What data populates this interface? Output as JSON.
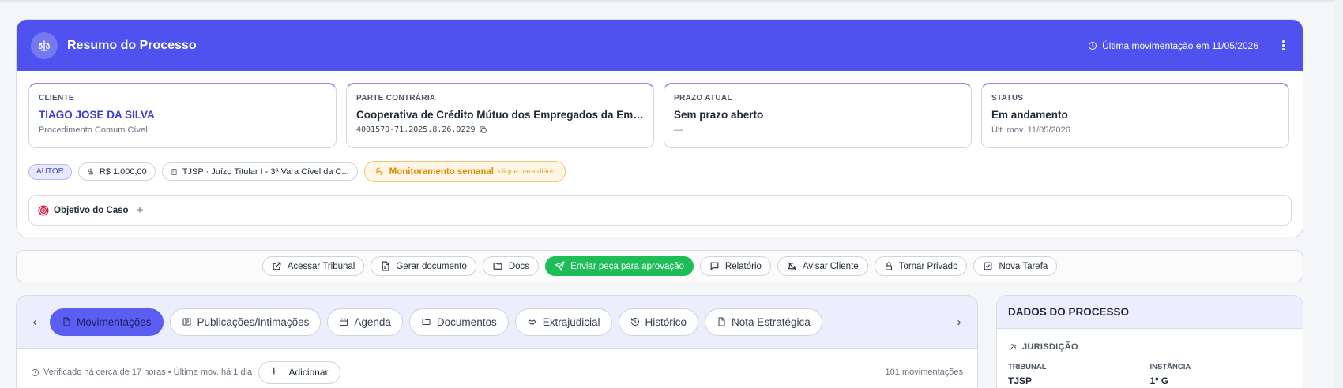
{
  "summary": {
    "title": "Resumo do Processo",
    "last_movement": "Última movimentação em 11/05/2026",
    "cards": [
      {
        "label": "CLIENTE",
        "value": "TIAGO JOSE DA SILVA",
        "sub": "Procedimento Comum Cível"
      },
      {
        "label": "PARTE CONTRÁRIA",
        "value": "Cooperativa de Crédito Mútuo dos Empregados da Embr...",
        "sub": "4001570-71.2025.8.26.0229"
      },
      {
        "label": "PRAZO ATUAL",
        "value": "Sem prazo aberto",
        "sub": "—"
      },
      {
        "label": "STATUS",
        "value": "Em andamento",
        "sub": "Últ. mov. 11/05/2026"
      }
    ],
    "chips": {
      "role": "AUTOR",
      "amount": "R$ 1.000,00",
      "court": "TJSP · Juízo Titular I - 3ª Vara Cível da C...",
      "monitor_label": "Monitoramento semanal",
      "monitor_hint": "clique para diário"
    },
    "objective_label": "Objetivo do Caso",
    "objective_add": "+"
  },
  "actions": [
    {
      "label": "Acessar Tribunal",
      "icon": "external-link-icon"
    },
    {
      "label": "Gerar documento",
      "icon": "document-icon"
    },
    {
      "label": "Docs",
      "icon": "folder-icon"
    },
    {
      "label": "Enviar peça para aprovação",
      "icon": "send-icon"
    },
    {
      "label": "Relatório",
      "icon": "message-icon"
    },
    {
      "label": "Avisar Cliente",
      "icon": "bell-off-icon"
    },
    {
      "label": "Tornar Privado",
      "icon": "lock-icon"
    },
    {
      "label": "Nova Tarefa",
      "icon": "checkbox-icon"
    }
  ],
  "tabs": [
    {
      "label": "Movimentações",
      "active": true
    },
    {
      "label": "Publicações/Intimações"
    },
    {
      "label": "Agenda"
    },
    {
      "label": "Documentos"
    },
    {
      "label": "Extrajudicial"
    },
    {
      "label": "Histórico"
    },
    {
      "label": "Nota Estratégica"
    }
  ],
  "timeline": {
    "verified": "Verificado há cerca de 17 horas • Última mov. há 1 dia",
    "add_label": "Adicionar",
    "add_symbol": "+",
    "count": "101 movimentações"
  },
  "side": {
    "title": "DADOS DO PROCESSO",
    "section": "JURISDIÇÃO",
    "col1_label": "TRIBUNAL",
    "col1_value": "TJSP",
    "col2_label": "INSTÂNCIA",
    "col2_value": "1º G"
  },
  "colors": {
    "header": "#4f52ee",
    "active_tab": "#5b5ef0",
    "primary_action": "#1fbd58",
    "monitor": "#e08a00"
  }
}
